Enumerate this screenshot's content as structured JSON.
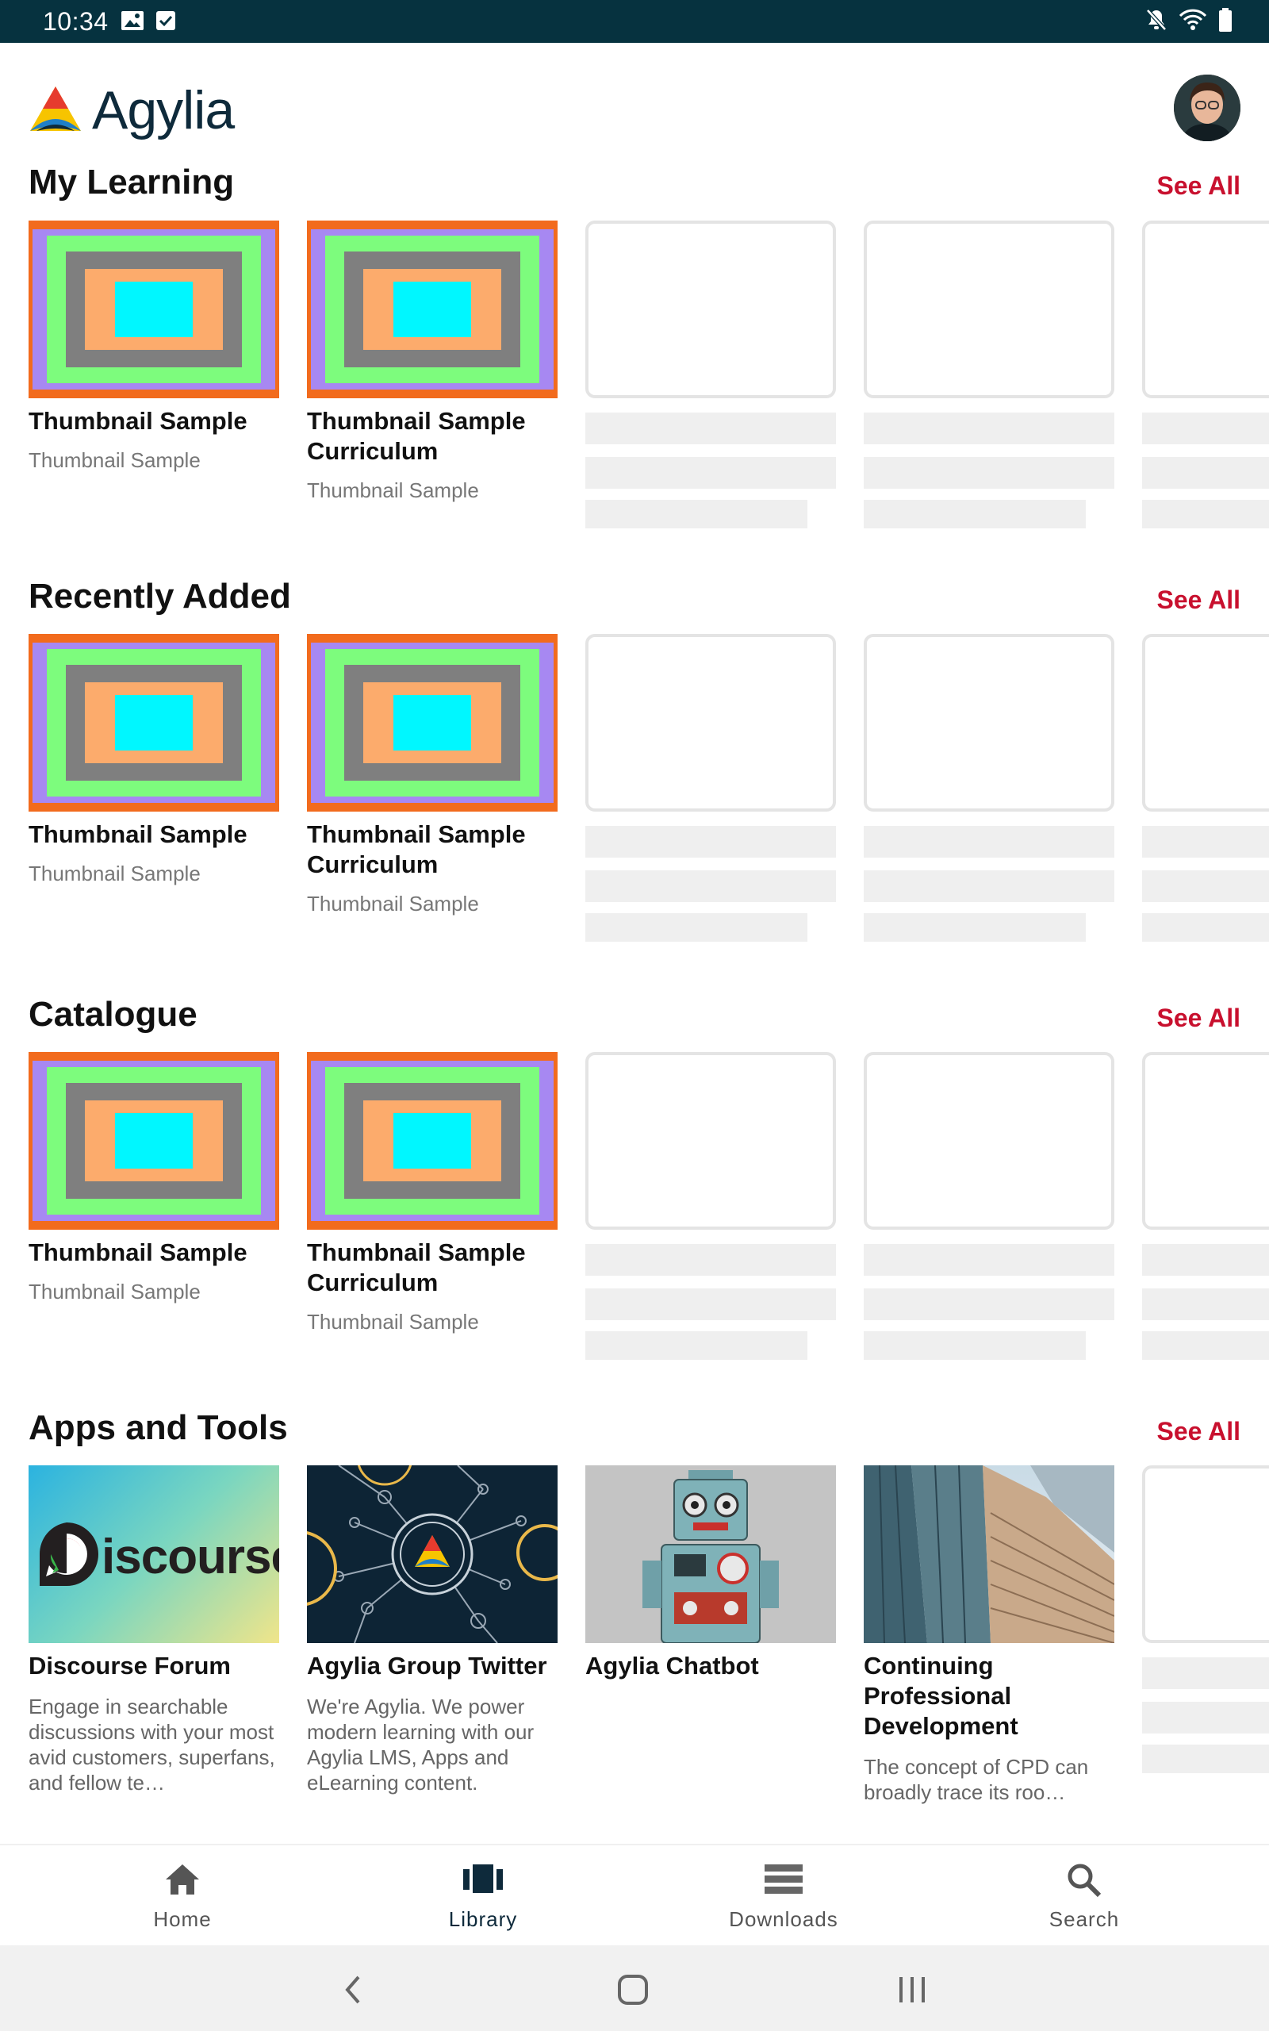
{
  "status_bar": {
    "time": "10:34"
  },
  "header": {
    "logo_text": "Agylia"
  },
  "sections": [
    {
      "title": "My Learning",
      "see_all": "See All",
      "cards": [
        {
          "title": "Thumbnail Sample",
          "subtitle": "Thumbnail Sample"
        },
        {
          "title": "Thumbnail Sample Curriculum",
          "subtitle": "Thumbnail Sample"
        }
      ]
    },
    {
      "title": "Recently Added",
      "see_all": "See All",
      "cards": [
        {
          "title": "Thumbnail Sample",
          "subtitle": "Thumbnail Sample"
        },
        {
          "title": "Thumbnail Sample Curriculum",
          "subtitle": "Thumbnail Sample"
        }
      ]
    },
    {
      "title": "Catalogue",
      "see_all": "See All",
      "cards": [
        {
          "title": "Thumbnail Sample",
          "subtitle": "Thumbnail Sample"
        },
        {
          "title": "Thumbnail Sample Curriculum",
          "subtitle": "Thumbnail Sample"
        }
      ]
    }
  ],
  "apps": {
    "title": "Apps and Tools",
    "see_all": "See All",
    "items": [
      {
        "title": "Discourse Forum",
        "logo_text": "iscourse",
        "description": "Engage in searchable discussions with your most avid customers, superfans, and fellow te…"
      },
      {
        "title": "Agylia Group Twitter",
        "description": "We're Agylia. We power modern learning with our Agylia LMS, Apps and eLearning content."
      },
      {
        "title": "Agylia Chatbot",
        "description": ""
      },
      {
        "title": "Continuing Professional Development",
        "description": "The concept of CPD can broadly trace its roo…"
      }
    ]
  },
  "bottom_nav": [
    {
      "label": "Home",
      "icon": "home-icon",
      "active": false
    },
    {
      "label": "Library",
      "icon": "library-icon",
      "active": true
    },
    {
      "label": "Downloads",
      "icon": "downloads-icon",
      "active": false
    },
    {
      "label": "Search",
      "icon": "search-icon",
      "active": false
    }
  ],
  "colors": {
    "status_bar": "#06323f",
    "see_all": "#c8102e",
    "thumb_border": "#f26b1d",
    "nav_active": "#0e2a3b"
  }
}
